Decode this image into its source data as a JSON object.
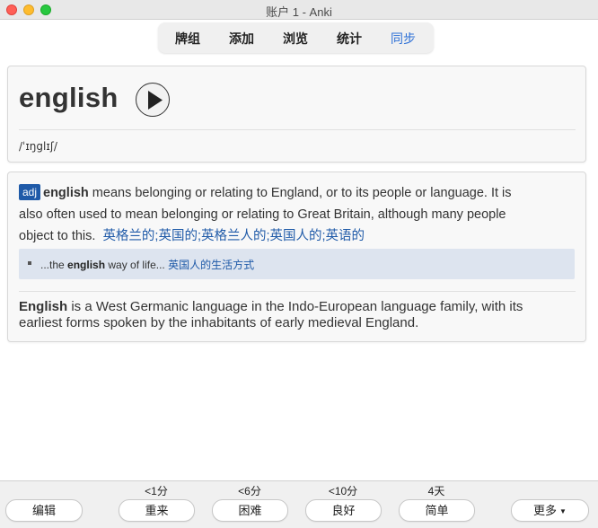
{
  "window": {
    "title": "账户 1 - Anki"
  },
  "nav": {
    "decks": "牌组",
    "add": "添加",
    "browse": "浏览",
    "stats": "统计",
    "sync": "同步"
  },
  "card": {
    "word": "english",
    "phonetic": "/ˈɪŋglɪʃ/",
    "play_icon": "play-icon",
    "pos": "adj",
    "def_headword": "english",
    "def_line1": " means belonging or relating to England, or to its people or language. It is",
    "def_line2": "also often used to mean belonging or relating to Great Britain, although many people",
    "def_line3": "object to this.",
    "def_zh": "英格兰的;英国的;英格兰人的;英国人的;英语的",
    "example_pre": "...the ",
    "example_bold": "english",
    "example_post": " way of life...",
    "example_zh": "英国人的生活方式",
    "wiki_headword": "English",
    "wiki_line1": " is a West Germanic language in the Indo-European language family, with its",
    "wiki_line2": "earliest forms spoken by the inhabitants of early medieval England."
  },
  "bottom": {
    "edit": "编辑",
    "again_interval": "<1分",
    "again": "重来",
    "hard_interval": "<6分",
    "hard": "困难",
    "good_interval": "<10分",
    "good": "良好",
    "easy_interval": "4天",
    "easy": "简单",
    "more": "更多"
  },
  "colors": {
    "accent": "#2c6fd6",
    "pos_badge": "#1f5aa8",
    "chinese_text": "#1f5aa8",
    "example_bg": "#dde4ef"
  }
}
